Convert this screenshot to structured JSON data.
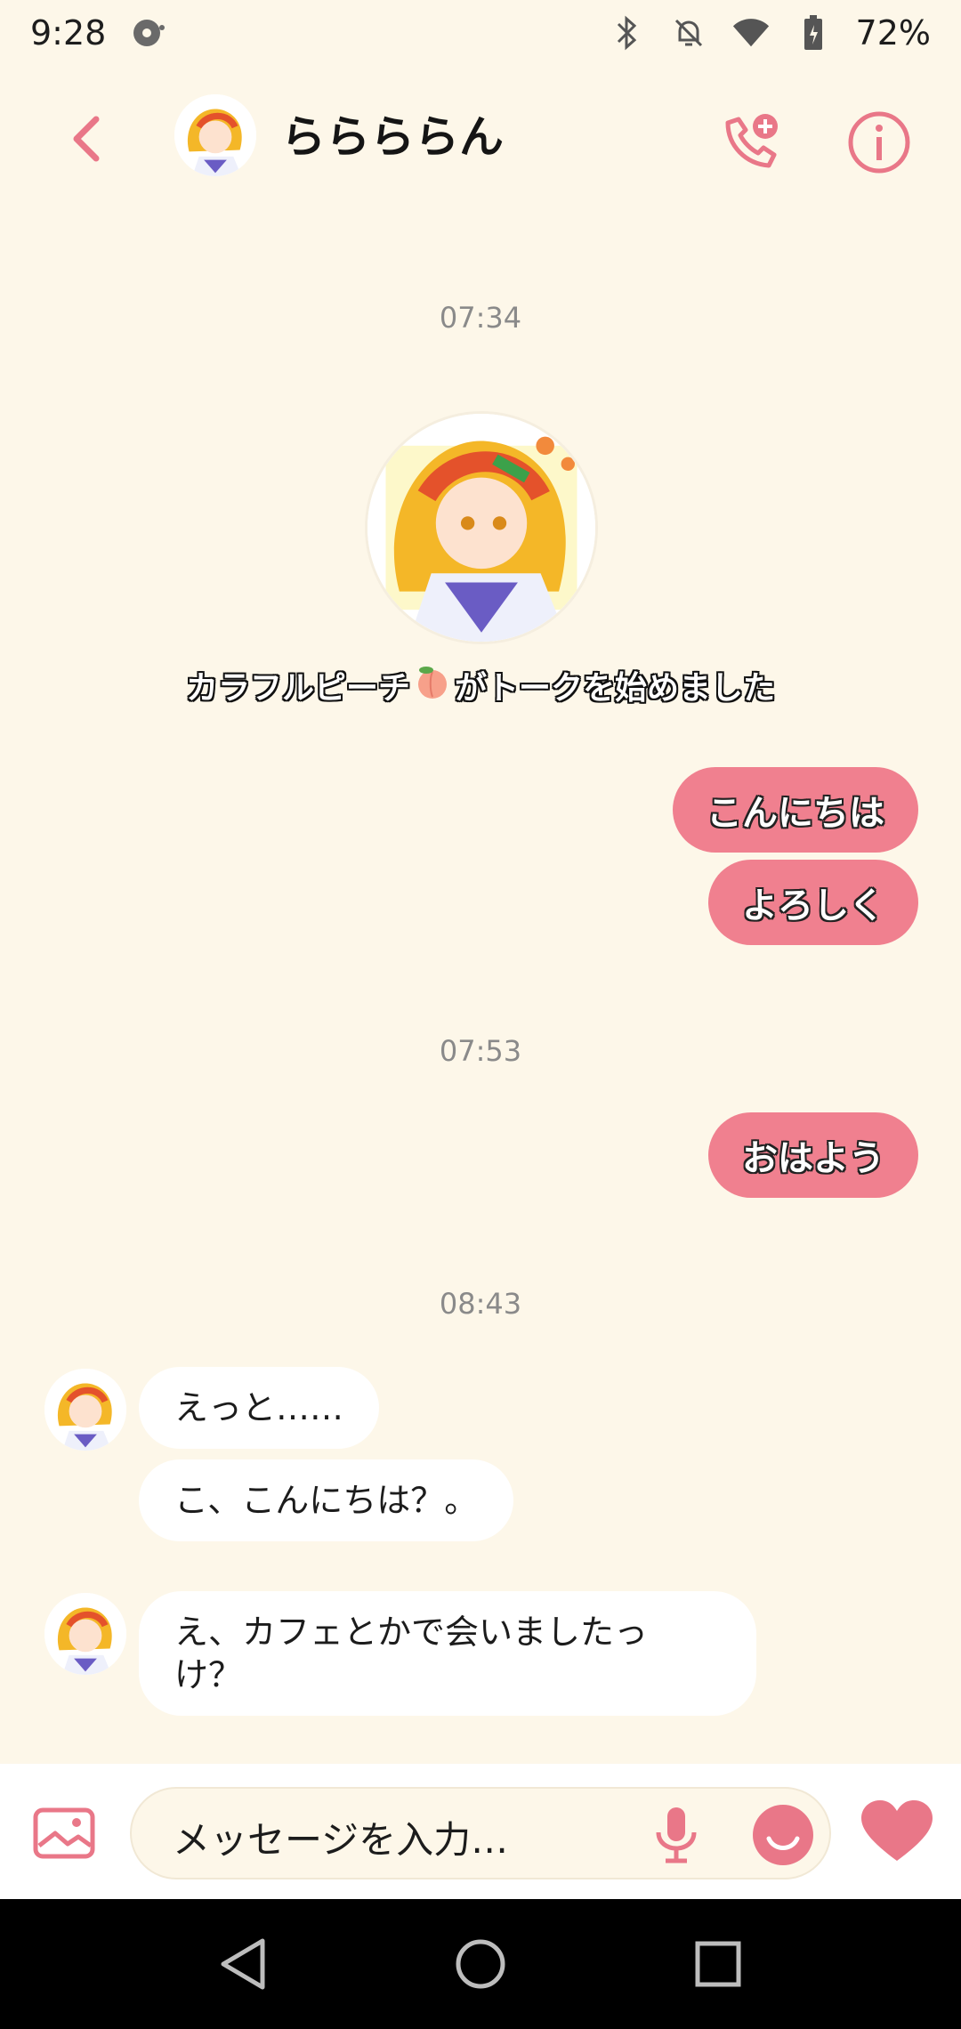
{
  "status_bar": {
    "time": "9:28",
    "battery": "72%"
  },
  "header": {
    "contact_name": "ららららん"
  },
  "chat": {
    "time_1": "07:34",
    "started_text_a": "カラフルピーチ",
    "started_text_b": "がトークを始めました",
    "me_1": "こんにちは",
    "me_2": "よろしく",
    "time_2": "07:53",
    "me_3": "おはよう",
    "time_3": "08:43",
    "them_1": "えっと……",
    "them_2": "こ、こんにちは？。",
    "them_3_line1": "え、カフェとかで会いましたっ",
    "them_3_line2": "け？"
  },
  "input": {
    "placeholder": "メッセージを入力…"
  },
  "colors": {
    "accent": "#f0808f",
    "background": "#fdf7e9",
    "bubble_them": "#ffffff"
  },
  "icons": [
    "back-arrow-icon",
    "call-add-icon",
    "info-icon",
    "gallery-icon",
    "mic-icon",
    "emoji-icon",
    "heart-icon",
    "nav-back-icon",
    "nav-home-icon",
    "nav-recents-icon"
  ]
}
